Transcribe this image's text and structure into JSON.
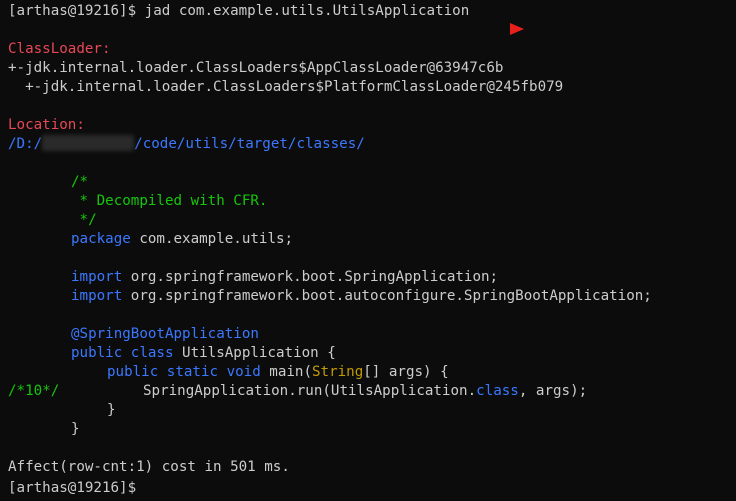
{
  "prompt": "[arthas@19216]$",
  "command": " jad com.example.utils.UtilsApplication",
  "classloader": {
    "label": "ClassLoader:",
    "lines": [
      "+-jdk.internal.loader.ClassLoaders$AppClassLoader@63947c6b",
      "  +-jdk.internal.loader.ClassLoaders$PlatformClassLoader@245fb079"
    ]
  },
  "location": {
    "label": "Location:",
    "path_prefix": "/D:/",
    "path_suffix": "/code/utils/target/classes/"
  },
  "code": {
    "comment1": "/*",
    "comment2": " * Decompiled with CFR.",
    "comment3": " */",
    "package_kw": "package",
    "package_name": " com.example.utils;",
    "import_kw": "import",
    "import1": " org.springframework.boot.SpringApplication;",
    "import2": " org.springframework.boot.autoconfigure.SpringBootApplication;",
    "annotation": "@SpringBootApplication",
    "public_kw": "public",
    "class_kw": "class",
    "class_name": " UtilsApplication {",
    "static_kw": "static",
    "void_kw": "void",
    "main_open": " main(",
    "string_type": "String",
    "main_close": "[] args) {",
    "line_marker": "/*10*/",
    "run_call": "SpringApplication.run(UtilsApplication.",
    "run_class_kw": "class",
    "run_end": ", args);",
    "close_inner": "}",
    "close_outer": "}"
  },
  "affect": "Affect(row-cnt:1) cost in 501 ms.",
  "colors": {
    "background": "#0c0c0c",
    "text": "#cccccc",
    "label_red": "#e74856",
    "path_blue": "#3b78ff",
    "comment_green": "#16c60c",
    "type_yellow": "#c19c00",
    "arrow_red": "#e8201c"
  }
}
